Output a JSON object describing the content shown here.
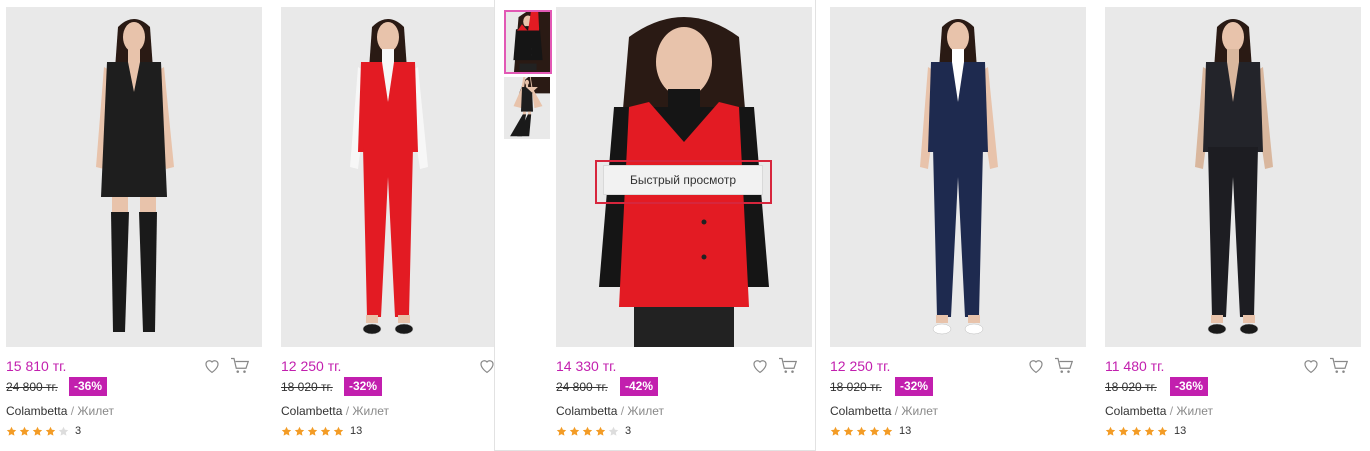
{
  "products": [
    {
      "price": "15 810 тг.",
      "old_price": "24 800 тг.",
      "discount": "-36%",
      "brand": "Colambetta",
      "separator": "/",
      "type": "Жилет",
      "stars": 4,
      "reviews": "3",
      "outfit": "black-dress"
    },
    {
      "price": "12 250 тг.",
      "old_price": "18 020 тг.",
      "discount": "-32%",
      "brand": "Colambetta",
      "separator": "/",
      "type": "Жилет",
      "stars": 5,
      "reviews": "13",
      "outfit": "red-suit"
    },
    {
      "price": "14 330 тг.",
      "old_price": "24 800 тг.",
      "discount": "-42%",
      "brand": "Colambetta",
      "separator": "/",
      "type": "Жилет",
      "stars": 4,
      "reviews": "3",
      "outfit": "red-vest"
    },
    {
      "price": "12 250 тг.",
      "old_price": "18 020 тг.",
      "discount": "-32%",
      "brand": "Colambetta",
      "separator": "/",
      "type": "Жилет",
      "stars": 5,
      "reviews": "13",
      "outfit": "navy-suit"
    },
    {
      "price": "11 480 тг.",
      "old_price": "18 020 тг.",
      "discount": "-36%",
      "brand": "Colambetta",
      "separator": "/",
      "type": "Жилет",
      "stars": 5,
      "reviews": "13",
      "outfit": "black-suit"
    }
  ],
  "quick_view": {
    "label": "Быстрый просмотр"
  },
  "thumbnails": [
    "red-vest",
    "black-dress"
  ],
  "colors": {
    "accent": "#c21fae",
    "star": "#f39c26",
    "star_empty": "#dddddd",
    "highlight": "#d7263d"
  },
  "icons": {
    "favorite": "heart-icon",
    "cart": "cart-icon",
    "rating": "star-icon"
  }
}
